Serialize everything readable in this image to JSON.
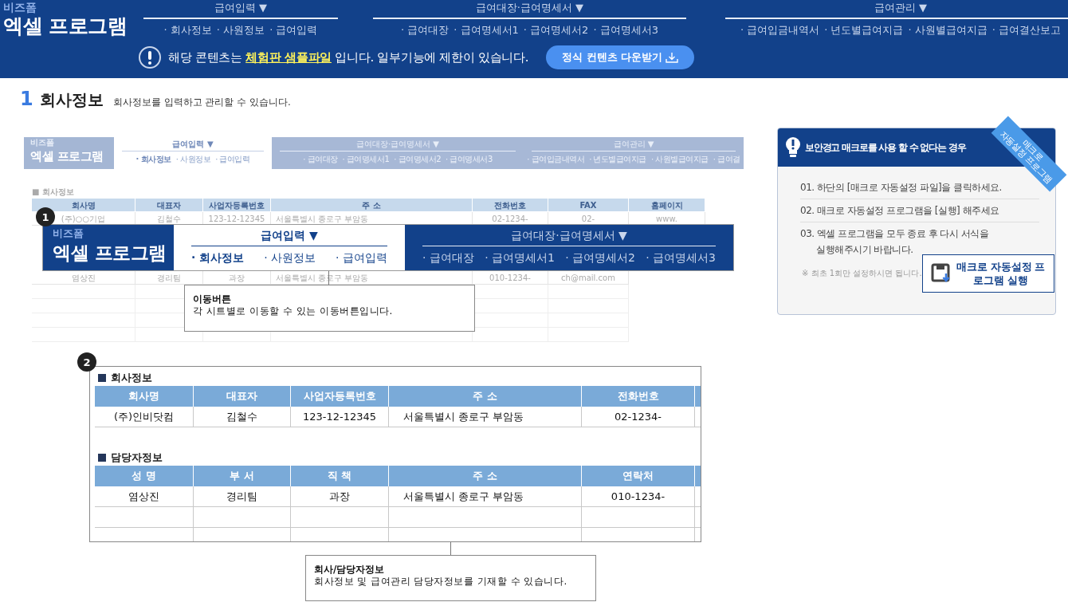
{
  "header": {
    "brand": {
      "small": "비즈폼",
      "big": "엑셀 프로그램"
    },
    "menus": [
      {
        "title": "급여입력 ▼",
        "items": [
          "· 회사정보",
          "· 사원정보",
          "· 급여입력"
        ]
      },
      {
        "title": "급여대장·급여명세서 ▼",
        "items": [
          "· 급여대장",
          "· 급여명세서1",
          "· 급여명세서2",
          "· 급여명세서3"
        ]
      },
      {
        "title": "급여관리 ▼",
        "items": [
          "· 급여입금내역서",
          "· 년도별급여지급",
          "· 사원별급여지급",
          "· 급여결산보고"
        ]
      }
    ],
    "notice": {
      "before": "해당 콘텐츠는 ",
      "link": "체험판  샘플파일",
      "after": " 입니다. 일부기능에 제한이 있습니다."
    },
    "download_button": "정식 컨텐츠 다운받기"
  },
  "section": {
    "number": "1",
    "title": "회사정보",
    "description": "회사정보를 입력하고 관리할 수 있습니다."
  },
  "sample": {
    "brand": {
      "small": "비즈폼",
      "big": "엑셀 프로그램"
    },
    "menus": [
      {
        "title": "급여입력 ▼",
        "selected": true,
        "items": [
          {
            "label": "· 회사정보",
            "selected": true
          },
          {
            "label": "· 사원정보",
            "selected": false
          },
          {
            "label": "· 급여입력",
            "selected": false
          }
        ]
      },
      {
        "title": "급여대장·급여명세서 ▼",
        "selected": false,
        "items": [
          {
            "label": "· 급여대장",
            "selected": false
          },
          {
            "label": "· 급여명세서1",
            "selected": false
          },
          {
            "label": "· 급여명세서2",
            "selected": false
          },
          {
            "label": "· 급여명세서3",
            "selected": false
          }
        ]
      },
      {
        "title": "급여관리 ▼",
        "selected": false,
        "items": [
          {
            "label": "· 급여입금내역서",
            "selected": false
          },
          {
            "label": "· 년도별급여지급",
            "selected": false
          },
          {
            "label": "· 사원별급여지급",
            "selected": false
          },
          {
            "label": "· 급여결",
            "selected": false
          }
        ]
      }
    ],
    "sheet": {
      "title": "■ 회사정보",
      "columns": [
        "회사명",
        "대표자",
        "사업자등록번호",
        "주 소",
        "전화번호",
        "FAX",
        "홈페이지"
      ],
      "rows": [
        [
          "(주)○○기업",
          "김철수",
          "123-12-12345",
          "서울특별시 종로구 부암동",
          "02-1234-",
          "02-",
          "www."
        ]
      ],
      "contact_rows": [
        [
          "염상진",
          "경리팀",
          "과장",
          "서울특별시 종로구 부암동",
          "010-1234-",
          "ch@mail.com"
        ]
      ]
    }
  },
  "zoom_1": {
    "badge": "1",
    "brand": {
      "small": "비즈폼",
      "big": "엑셀 프로그램"
    },
    "menus": [
      {
        "title": "급여입력 ▼",
        "selected": true,
        "items": [
          {
            "label": "· 회사정보",
            "selected": true
          },
          {
            "label": "· 사원정보",
            "selected": false
          },
          {
            "label": "· 급여입력",
            "selected": false
          }
        ]
      },
      {
        "title": "급여대장·급여명세서 ▼",
        "selected": false,
        "items": [
          {
            "label": "· 급여대장",
            "selected": false
          },
          {
            "label": "· 급여명세서1",
            "selected": false
          },
          {
            "label": "· 급여명세서2",
            "selected": false
          },
          {
            "label": "· 급여명세서3",
            "selected": false
          }
        ]
      }
    ]
  },
  "callout_1": {
    "title": "이동버튼",
    "text": "각 시트별로 이동할 수 있는 이동버튼입니다."
  },
  "zoom_2": {
    "badge": "2",
    "tables": [
      {
        "title": "회사정보",
        "columns": [
          "회사명",
          "대표자",
          "사업자등록번호",
          "주 소",
          "전화번호"
        ],
        "rows": [
          [
            "(주)인비닷컴",
            "김철수",
            "123-12-12345",
            "서울특별시 종로구 부암동",
            "02-1234-"
          ]
        ]
      },
      {
        "title": "담당자정보",
        "columns": [
          "성 명",
          "부 서",
          "직 책",
          "주 소",
          "연락처"
        ],
        "rows": [
          [
            "염상진",
            "경리팀",
            "과장",
            "서울특별시 종로구 부암동",
            "010-1234-"
          ]
        ]
      }
    ]
  },
  "callout_2": {
    "title": "회사/담당자정보",
    "text": "회사정보 및 급여관리 담당자정보를 기재할 수 있습니다."
  },
  "macro_panel": {
    "title": "보안경고 매크로를 사용 할 수 없다는 경우",
    "ribbon": [
      "매크로",
      "자동설정 프로그램"
    ],
    "steps": [
      {
        "text": "01. 하단의 [매크로 자동설정 파일]을 클릭하세요."
      },
      {
        "text": "02. 매크로 자동설정 프로그램을 [실행] 해주세요"
      },
      {
        "text": "03. 엑셀 프로그램을 모두 종료 후 다시 서식을 실행해주시기 바랍니다."
      }
    ],
    "note": "※ 최초 1회만 설정하시면 됩니다.",
    "button": "매크로 자동설정 프로그램 실행"
  }
}
